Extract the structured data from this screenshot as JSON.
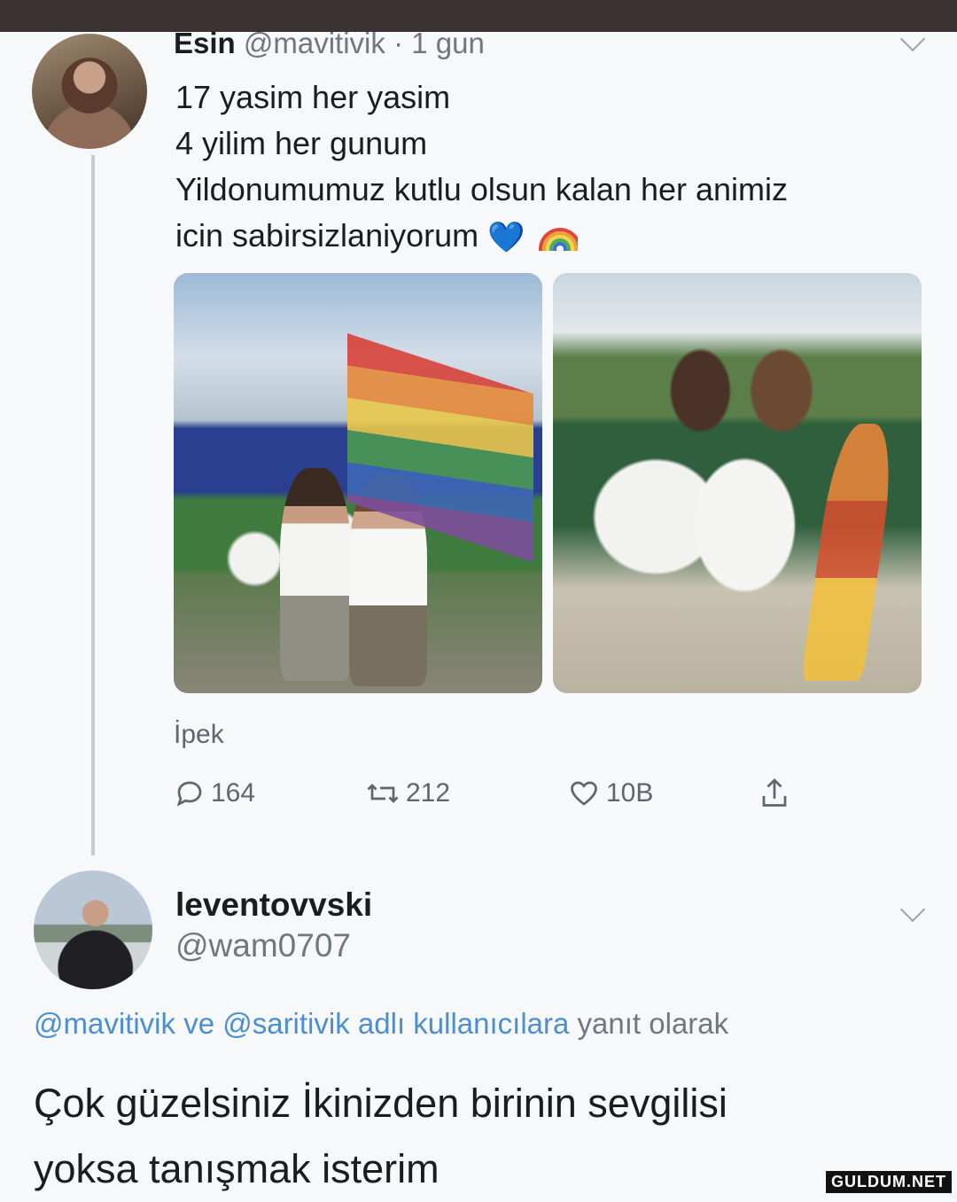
{
  "tweet1": {
    "name": "Esin",
    "handle": "@mavitivik",
    "time": "· 1 gun",
    "lines": [
      "17 yasim her yasim",
      "4 yilim her gunum",
      "Yildonumumuz kutlu olsun kalan her animiz",
      "icin sabirsizlaniyorum"
    ],
    "emoji_heart": "💙",
    "tag": "İpek",
    "replies": "164",
    "retweets": "212",
    "likes": "10B",
    "icons": [
      "reply-icon",
      "retweet-icon",
      "like-icon",
      "share-icon",
      "chevron-down-icon"
    ]
  },
  "tweet2": {
    "name": "leventovvski",
    "handle": "@wam0707",
    "reply_mention1": "@mavitivik",
    "reply_and": "ve",
    "reply_mention2": "@saritivik",
    "reply_mid": "adlı kullanıcılara",
    "reply_suffix": "yanıt olarak",
    "lines": [
      "Çok güzelsiniz İkinizden birinin sevgilisi",
      "yoksa tanışmak isterim"
    ]
  },
  "watermark": "GULDUM.NET",
  "colors": {
    "accent": "#4b8fd0",
    "text": "#1a1c1f",
    "muted": "#6f7780",
    "topbar": "#3b3234"
  }
}
